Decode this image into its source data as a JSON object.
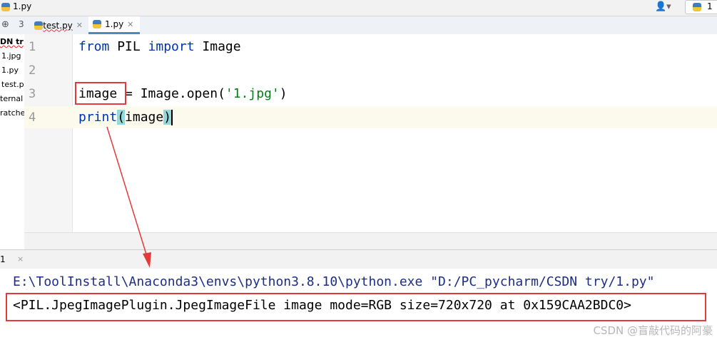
{
  "window": {
    "title": "1.py",
    "run_config_label": "1"
  },
  "tabs": [
    {
      "label": "test.py",
      "active": false
    },
    {
      "label": "1.py",
      "active": true
    }
  ],
  "project": {
    "items": [
      "DN tr",
      "1.jpg",
      "1.py",
      "test.p",
      "ternal",
      "ratche"
    ]
  },
  "editor": {
    "line_numbers": [
      "1",
      "2",
      "3",
      "4"
    ],
    "lines": {
      "l1": {
        "kw1": "from",
        "mod": " PIL ",
        "kw2": "import",
        "name": " Image"
      },
      "l3": {
        "var": "image",
        "mid": " = Image.open(",
        "str": "'1.jpg'",
        "end": ")"
      },
      "l4": {
        "fn": "print",
        "open": "(",
        "arg": "image",
        "close": ")"
      }
    }
  },
  "run_panel": {
    "tab_label": "1",
    "close": "×"
  },
  "console": {
    "command": "E:\\ToolInstall\\Anaconda3\\envs\\python3.8.10\\python.exe \"D:/PC_pycharm/CSDN try/1.py\"",
    "output": "<PIL.JpegImagePlugin.JpegImageFile image mode=RGB size=720x720 at 0x159CAA2BDC0>"
  },
  "watermark": "CSDN @盲敲代码的阿豪",
  "colors": {
    "keyword": "#0033b3",
    "string": "#067d17",
    "annotation": "#e33b3b",
    "tab_accent": "#4a88c7"
  }
}
